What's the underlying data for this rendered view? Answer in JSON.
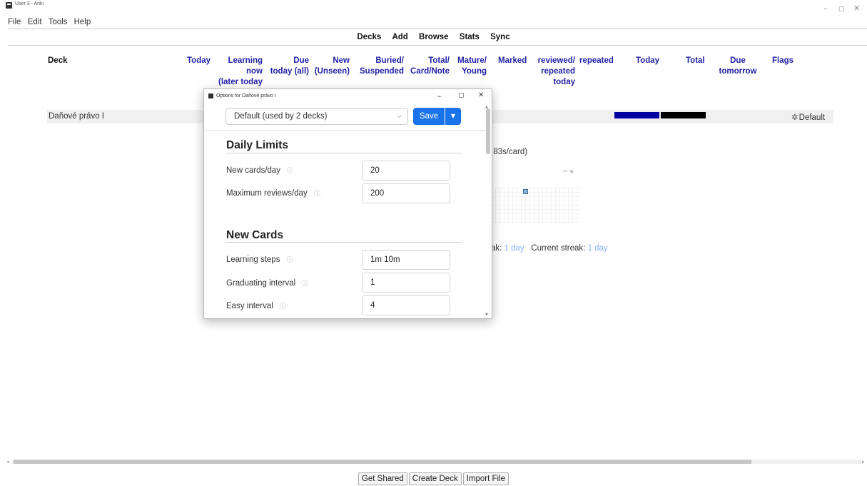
{
  "window": {
    "title": "User 3 - Anki",
    "min": "–",
    "max": "▢",
    "close": "✕"
  },
  "menu": [
    "File",
    "Edit",
    "Tools",
    "Help"
  ],
  "toolbar": [
    "Decks",
    "Add",
    "Browse",
    "Stats",
    "Sync"
  ],
  "table": {
    "headers": {
      "deck": "Deck",
      "today": "Today",
      "learning": [
        "Learning",
        "now",
        "(later today"
      ],
      "due": [
        "Due",
        "today (all)"
      ],
      "new": [
        "New",
        "(Unseen)"
      ],
      "buried": [
        "Buried/",
        "Suspended"
      ],
      "total": [
        "Total/",
        "Card/Note"
      ],
      "mature": [
        "Mature/",
        "Young"
      ],
      "marked": "Marked",
      "reviewed": [
        "reviewed/",
        "repeated",
        "today"
      ],
      "repeated": "repeated",
      "today2": "Today",
      "total2": "Total",
      "due_tomorrow": [
        "Due",
        "tomorrow"
      ],
      "flags": "Flags"
    },
    "row": {
      "name": "Daňové právo I",
      "options": "Default",
      "gear_icon": "gear-icon"
    }
  },
  "background": {
    "seconds_per_card": ".83s/card)",
    "streak_prefix": "ak:",
    "streak_value": "1 day",
    "current_streak_label": "Current streak:",
    "current_streak_value": "1 day"
  },
  "buttons": {
    "get_shared": "Get Shared",
    "create_deck": "Create Deck",
    "import_file": "Import File"
  },
  "dialog": {
    "title": "Options for Daňové právo I",
    "preset": "Default (used by 2 decks)",
    "save": "Save",
    "sections": {
      "daily_limits": "Daily Limits",
      "new_cards": "New Cards"
    },
    "fields": {
      "new_cards_day": {
        "label": "New cards/day",
        "value": "20"
      },
      "max_reviews_day": {
        "label": "Maximum reviews/day",
        "value": "200"
      },
      "learning_steps": {
        "label": "Learning steps",
        "value": "1m 10m"
      },
      "graduating_interval": {
        "label": "Graduating interval",
        "value": "1"
      },
      "easy_interval": {
        "label": "Easy interval",
        "value": "4"
      }
    },
    "info_glyph": "ⓘ"
  },
  "colors": {
    "accent": "#1a73e8",
    "header": "#1f1fa6",
    "bar_blue": "#0000a0",
    "bar_black": "#000000"
  }
}
